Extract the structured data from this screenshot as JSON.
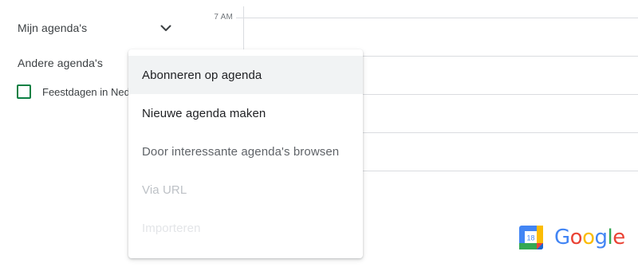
{
  "sidebar": {
    "my_calendars_label": "Mijn agenda's",
    "other_calendars_label": "Andere agenda's",
    "calendar_items": [
      {
        "label": "Feestdagen in Nederland",
        "color": "#0b8043",
        "checked": false
      }
    ]
  },
  "time_grid": {
    "first_time_label": "7 AM"
  },
  "add_calendar_menu": {
    "items": [
      {
        "label": "Abonneren op agenda",
        "state": "hovered"
      },
      {
        "label": "Nieuwe agenda maken",
        "state": "normal"
      },
      {
        "label": "Door interessante agenda's browsen",
        "state": "normal"
      },
      {
        "label": "Via URL",
        "state": "normal"
      },
      {
        "label": "Importeren",
        "state": "normal"
      }
    ]
  },
  "branding": {
    "calendar_icon_day": "18",
    "wordmark_letters": [
      "G",
      "o",
      "o",
      "g",
      "l",
      "e"
    ],
    "wordmark_colors": [
      "#4285f4",
      "#ea4335",
      "#fbbc05",
      "#4285f4",
      "#34a853",
      "#ea4335"
    ]
  }
}
